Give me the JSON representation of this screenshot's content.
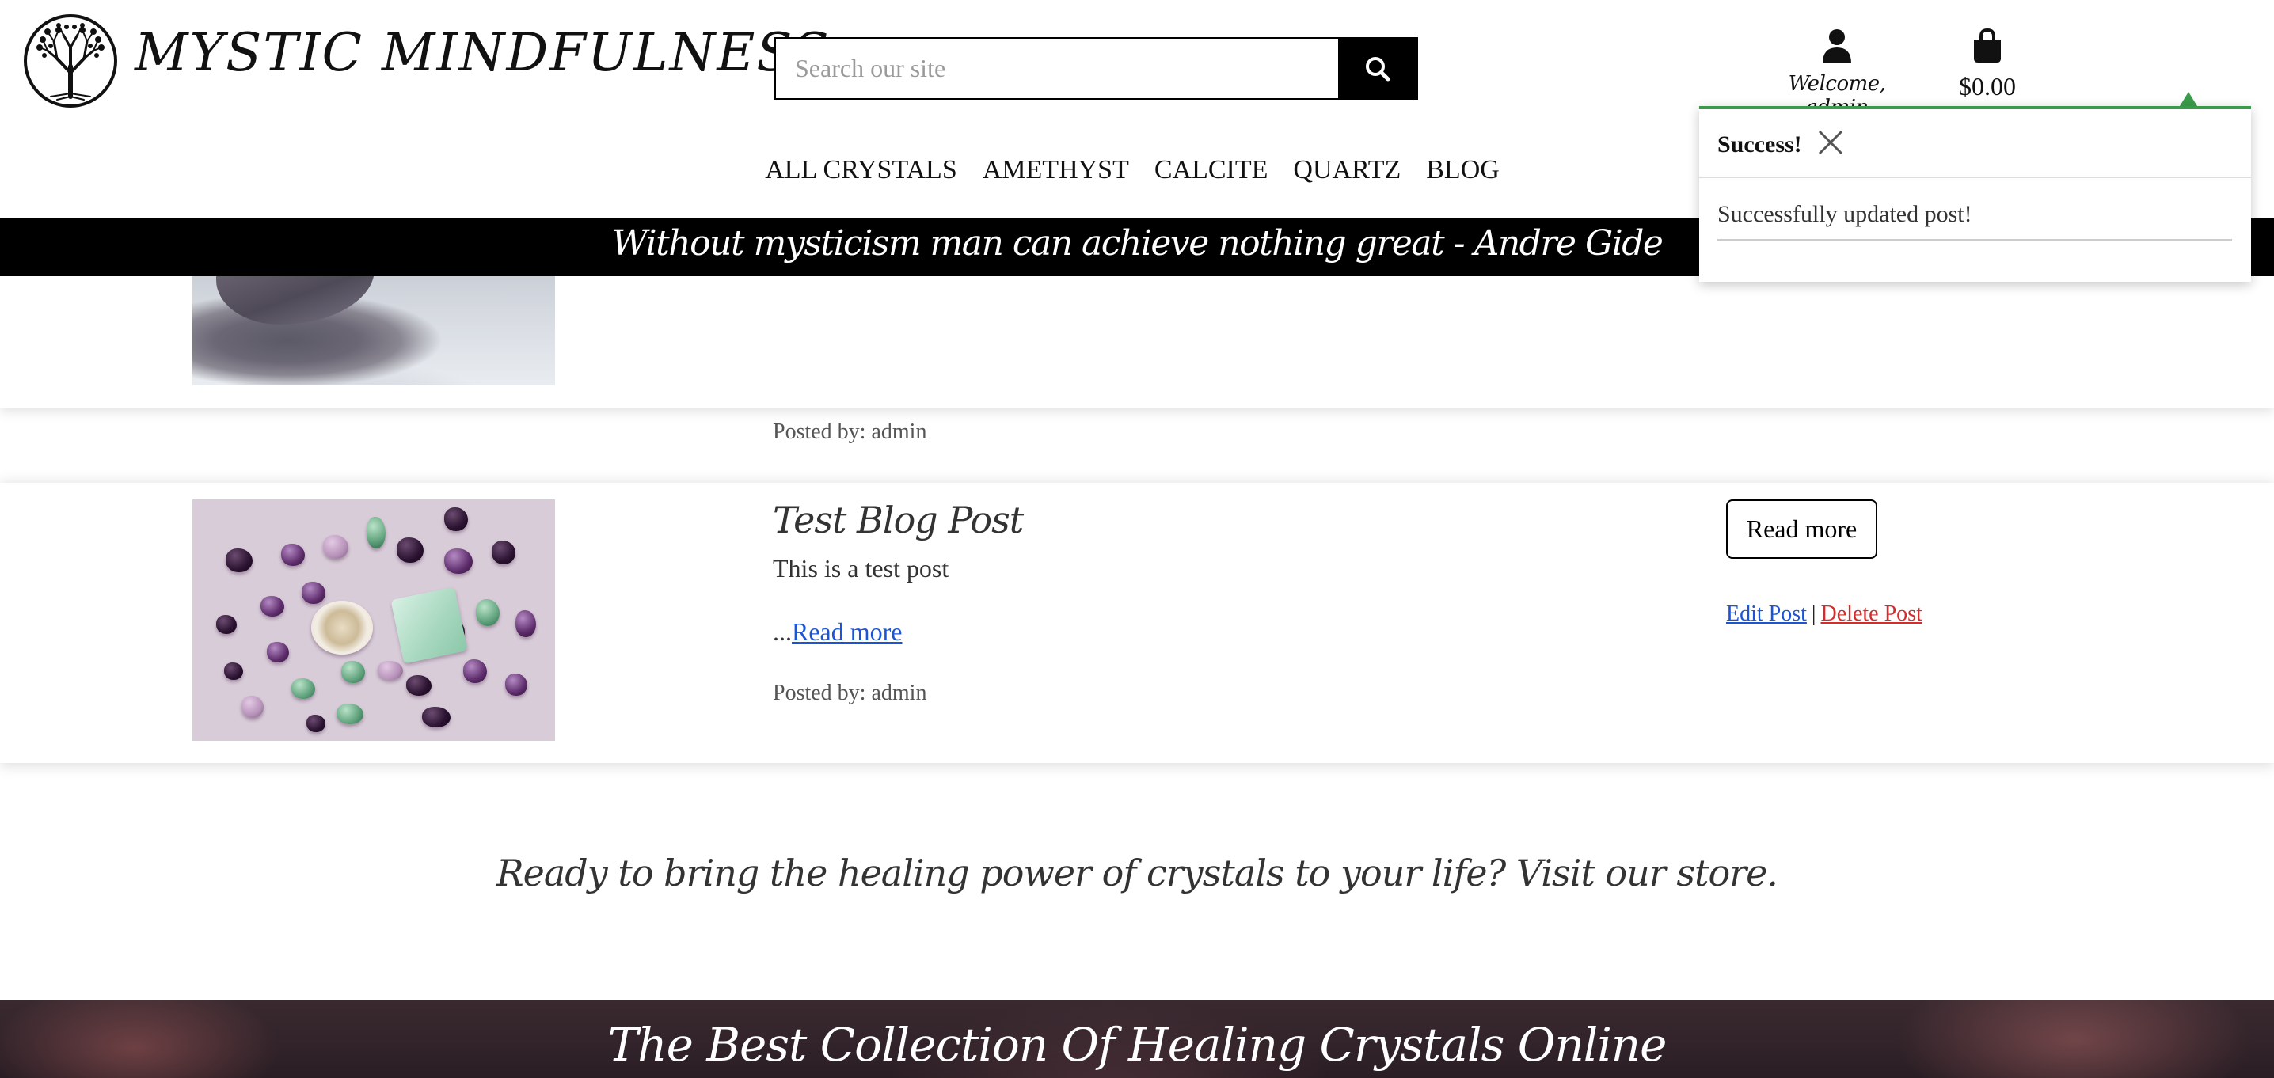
{
  "header": {
    "brand_name": "MYSTIC MINDFULNESS",
    "logo_icon": "tree-of-life-icon",
    "search": {
      "placeholder": "Search our site",
      "value": ""
    },
    "account": {
      "icon": "user-icon",
      "label": "Welcome, admin"
    },
    "cart": {
      "icon": "shopping-bag-icon",
      "total": "$0.00"
    },
    "nav": [
      {
        "label": "ALL CRYSTALS"
      },
      {
        "label": "AMETHYST"
      },
      {
        "label": "CALCITE"
      },
      {
        "label": "QUARTZ"
      },
      {
        "label": "BLOG"
      }
    ],
    "quote": "Without mysticism man can achieve nothing great - Andre Gide"
  },
  "toast": {
    "heading": "Success!",
    "message": "Successfully updated post!",
    "accent_color": "#3a9b4a"
  },
  "posts": [
    {
      "posted_by": "Posted by: admin"
    },
    {
      "title": "Test Blog Post",
      "summary": "This is a test post",
      "more_prefix": "...",
      "more_link": "Read more",
      "posted_by": "Posted by: admin",
      "read_more_button": "Read more",
      "edit_label": "Edit Post",
      "separator": "|",
      "delete_label": "Delete Post"
    }
  ],
  "cta": "Ready to bring the healing power of crystals to your life? Visit our store.",
  "footer": {
    "title": "The Best Collection Of Healing Crystals Online"
  },
  "colors": {
    "link": "#1b55d6",
    "delete": "#d52b2b",
    "banner": "#000000"
  }
}
